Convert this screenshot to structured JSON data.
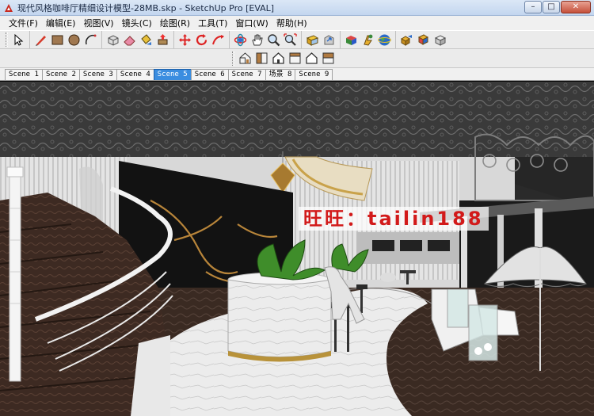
{
  "window": {
    "title": "现代风格咖啡厅精细设计模型-28MB.skp - SketchUp Pro [EVAL]",
    "minimize_glyph": "–",
    "maximize_glyph": "□",
    "close_glyph": "✕"
  },
  "menu": [
    {
      "label": "文件(F)"
    },
    {
      "label": "编辑(E)"
    },
    {
      "label": "视图(V)"
    },
    {
      "label": "镜头(C)"
    },
    {
      "label": "绘图(R)"
    },
    {
      "label": "工具(T)"
    },
    {
      "label": "窗口(W)"
    },
    {
      "label": "帮助(H)"
    }
  ],
  "toolbar_icons": [
    "select-arrow-icon",
    "pencil-line-icon",
    "rectangle-icon",
    "circle-icon",
    "arc-icon",
    "make-component-icon",
    "eraser-icon",
    "paint-bucket-icon",
    "push-pull-icon",
    "move-icon",
    "rotate-icon",
    "follow-me-icon",
    "orbit-icon",
    "pan-icon",
    "zoom-icon",
    "zoom-extents-icon",
    "get-models-icon",
    "share-model-icon",
    "3d-warehouse-icon",
    "extension-warehouse-icon",
    "google-earth-icon",
    "components-icon",
    "materials-icon",
    "styles-icon"
  ],
  "view_icons": [
    "iso-view-icon",
    "top-view-icon",
    "front-view-icon",
    "right-view-icon",
    "back-view-icon",
    "left-view-icon"
  ],
  "scenes": [
    {
      "label": "Scene 1",
      "active": false
    },
    {
      "label": "Scene 2",
      "active": false
    },
    {
      "label": "Scene 3",
      "active": false
    },
    {
      "label": "Scene 4",
      "active": false
    },
    {
      "label": "Scene 5",
      "active": true
    },
    {
      "label": "Scene 6",
      "active": false
    },
    {
      "label": "Scene 7",
      "active": false
    },
    {
      "label": "场景 8",
      "active": false
    },
    {
      "label": "Scene 9",
      "active": false
    }
  ],
  "watermark": "旺旺：tailin188",
  "colors": {
    "accent_tab": "#3a8de0",
    "watermark_text": "#d21a1a",
    "floor_white": "#e9e9e9",
    "floor_dark": "#3a2a22",
    "ceiling": "#3b3b3b"
  }
}
